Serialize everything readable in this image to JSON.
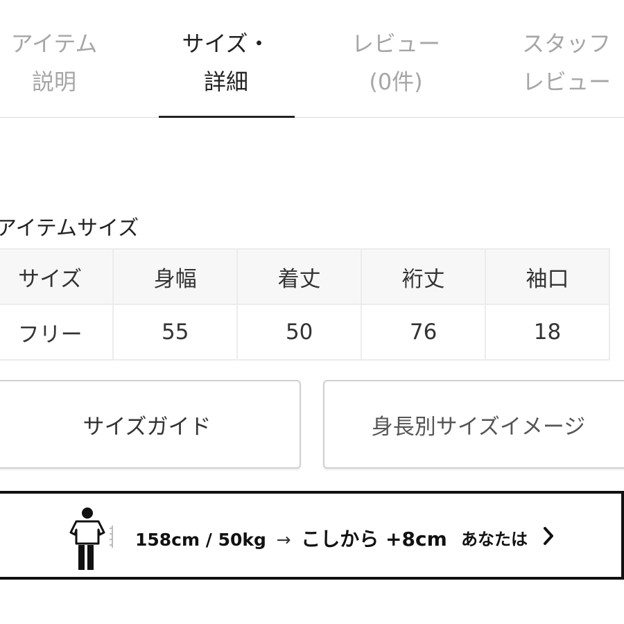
{
  "tabs": [
    {
      "line1": "アイテム",
      "line2": "説明"
    },
    {
      "line1": "サイズ・",
      "line2": "詳細"
    },
    {
      "line1": "レビュー",
      "line2": "(0件)"
    },
    {
      "line1": "スタッフ",
      "line2": "レビュー"
    }
  ],
  "active_tab": 1,
  "section": {
    "title": "アイテムサイズ"
  },
  "size_table": {
    "headers": [
      "サイズ",
      "身幅",
      "着丈",
      "裄丈",
      "袖口"
    ],
    "rows": [
      [
        "フリー",
        "55",
        "50",
        "76",
        "18"
      ]
    ]
  },
  "buttons": {
    "size_guide": "サイズガイド",
    "height_image": "身長別サイズイメージ"
  },
  "fit": {
    "stats": "158cm / 50kg",
    "arrow": "→",
    "result": "こしから +8cm",
    "you_label": "あなたは",
    "icon": "person-icon"
  },
  "colors": {
    "active_text": "#222222",
    "inactive_text": "#a6a6a6",
    "table_header_bg": "#f7f7f7",
    "border": "#ececec"
  }
}
